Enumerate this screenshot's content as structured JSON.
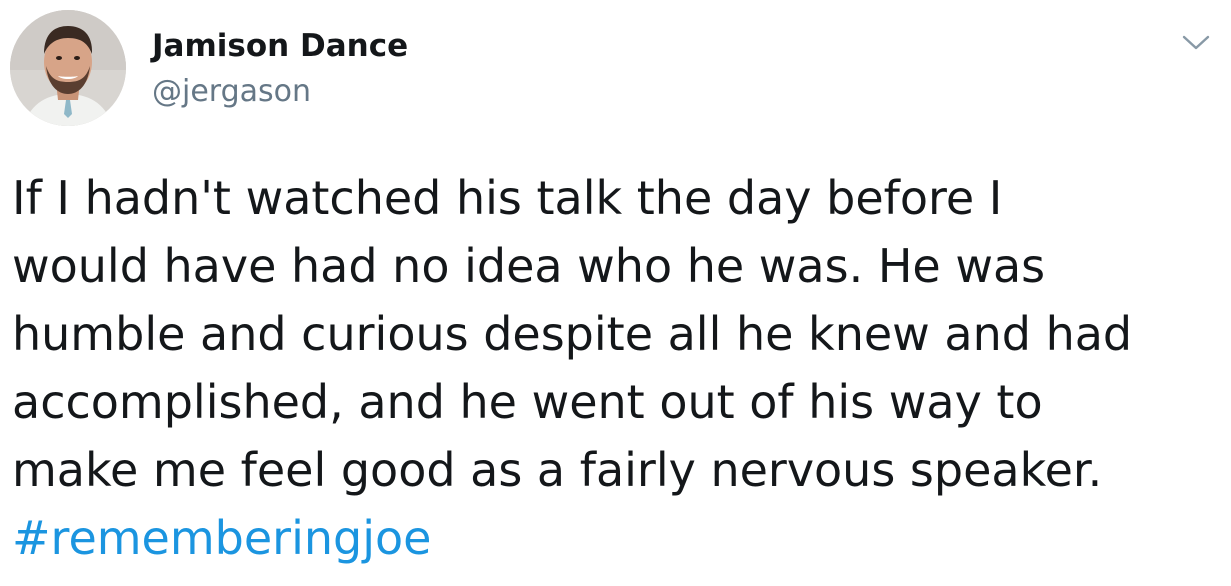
{
  "tweet": {
    "author": {
      "name": "Jamison Dance",
      "handle": "@jergason"
    },
    "menu_icon": "chevron-down-icon",
    "body_lines": [
      "If I hadn't watched his talk the day before I",
      "would have had no idea who he was. He was",
      "humble and curious despite all he knew and had",
      "accomplished, and he went out of his way to",
      "make me feel good as a fairly nervous speaker."
    ],
    "hashtag": "#rememberingjoe"
  },
  "colors": {
    "text": "#14171a",
    "handle": "#657786",
    "hashtag": "#1b95e0",
    "caret": "#8899a6"
  }
}
